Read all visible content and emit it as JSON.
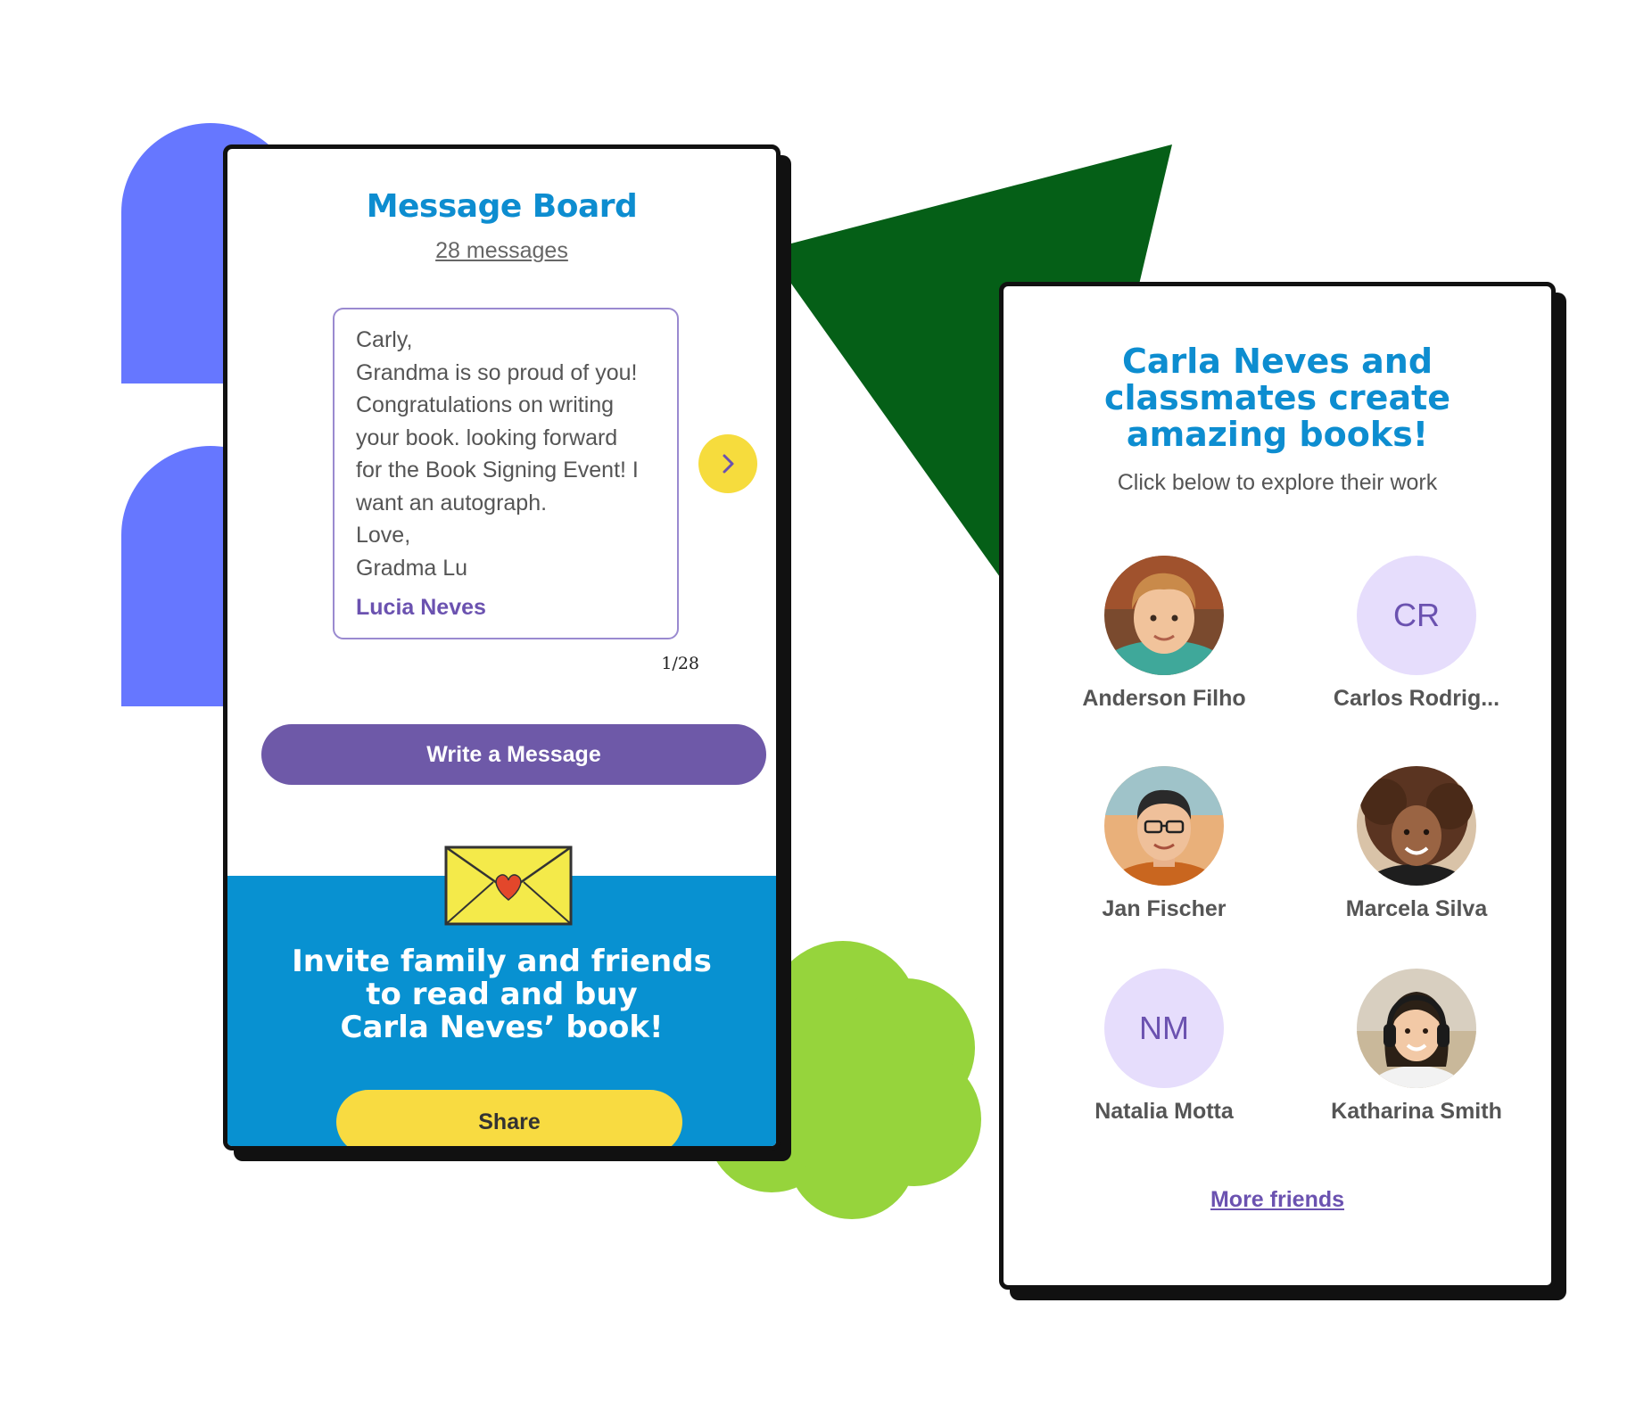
{
  "message_board": {
    "title": "Message Board",
    "count": "28 messages",
    "message": {
      "text": "Carly,\nGrandma is so proud of you!\nCongratulations on writing\nyour book. looking forward\nfor the Book Signing Event! I\nwant an autograph.\nLove,\nGradma Lu",
      "author": "Lucia Neves"
    },
    "pager": "1/28",
    "write_label": "Write a Message",
    "invite_text": "Invite family and friends\nto read and buy\nCarla Neves’ book!",
    "share_label": "Share"
  },
  "classmates": {
    "title": "Carla Neves and\nclassmates create\namazing books!",
    "subtitle": "Click below to explore their work",
    "friends": [
      {
        "name": "Anderson Filho",
        "avatar": "photo"
      },
      {
        "name": "Carlos Rodrig...",
        "avatar": "initials",
        "initials": "CR"
      },
      {
        "name": "Jan Fischer",
        "avatar": "photo"
      },
      {
        "name": "Marcela Silva",
        "avatar": "photo"
      },
      {
        "name": "Natalia Motta",
        "avatar": "initials",
        "initials": "NM"
      },
      {
        "name": "Katharina Smith",
        "avatar": "photo"
      }
    ],
    "more_label": "More friends"
  },
  "colors": {
    "accent_blue": "#0d8dd0",
    "purple": "#6e59a8",
    "yellow": "#f8db41",
    "green_dark": "#055f17",
    "green_light": "#96d43c",
    "periwinkle": "#6677ff"
  },
  "icons": {
    "next": "chevron-right-icon",
    "envelope": "envelope-heart-icon"
  }
}
